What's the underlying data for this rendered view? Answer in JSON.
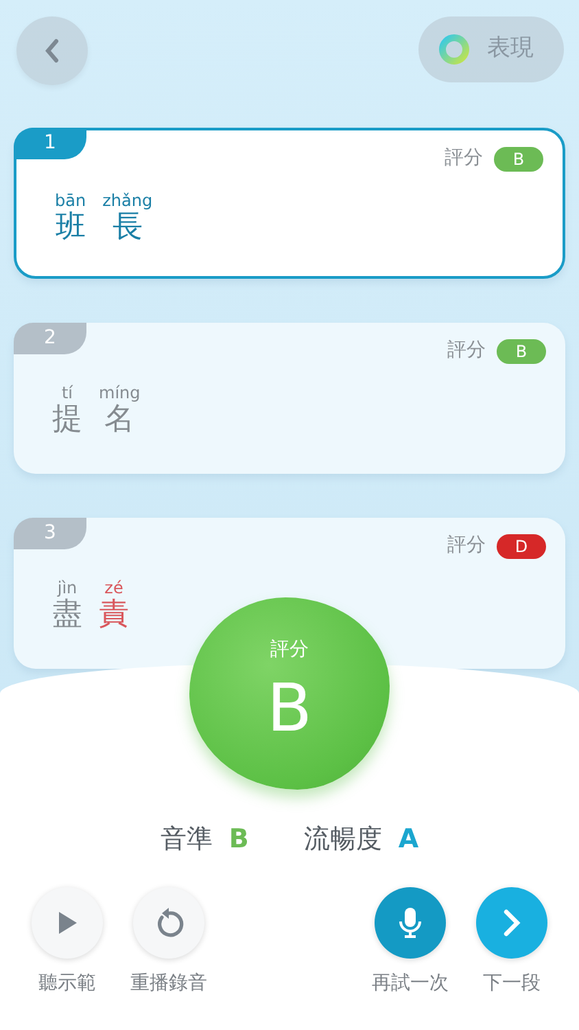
{
  "header": {
    "performance_label": "表現"
  },
  "items": [
    {
      "number": "1",
      "selected": true,
      "grade_label": "評分",
      "grade": "B",
      "color": "#6cbb55",
      "syllables": [
        {
          "pinyin": "bān",
          "hanzi": "班",
          "error": false
        },
        {
          "pinyin": "zhǎng",
          "hanzi": "長",
          "error": false
        }
      ]
    },
    {
      "number": "2",
      "selected": false,
      "grade_label": "評分",
      "grade": "B",
      "color": "#6cbb55",
      "syllables": [
        {
          "pinyin": "tí",
          "hanzi": "提",
          "error": false
        },
        {
          "pinyin": "míng",
          "hanzi": "名",
          "error": false
        }
      ]
    },
    {
      "number": "3",
      "selected": false,
      "grade_label": "評分",
      "grade": "D",
      "color": "#d62828",
      "syllables": [
        {
          "pinyin": "jìn",
          "hanzi": "盡",
          "error": false
        },
        {
          "pinyin": "zé",
          "hanzi": "責",
          "error": true
        }
      ]
    }
  ],
  "result": {
    "label": "評分",
    "grade": "B",
    "metrics": [
      {
        "label": "音準",
        "value": "B",
        "color": "#6cbb55"
      },
      {
        "label": "流暢度",
        "value": "A",
        "color": "#1ba6cf"
      }
    ]
  },
  "actions": [
    {
      "kind": "play",
      "label": "聽示範"
    },
    {
      "kind": "replay",
      "label": "重播錄音"
    },
    {
      "kind": "record",
      "label": "再試一次"
    },
    {
      "kind": "next",
      "label": "下一段"
    }
  ]
}
